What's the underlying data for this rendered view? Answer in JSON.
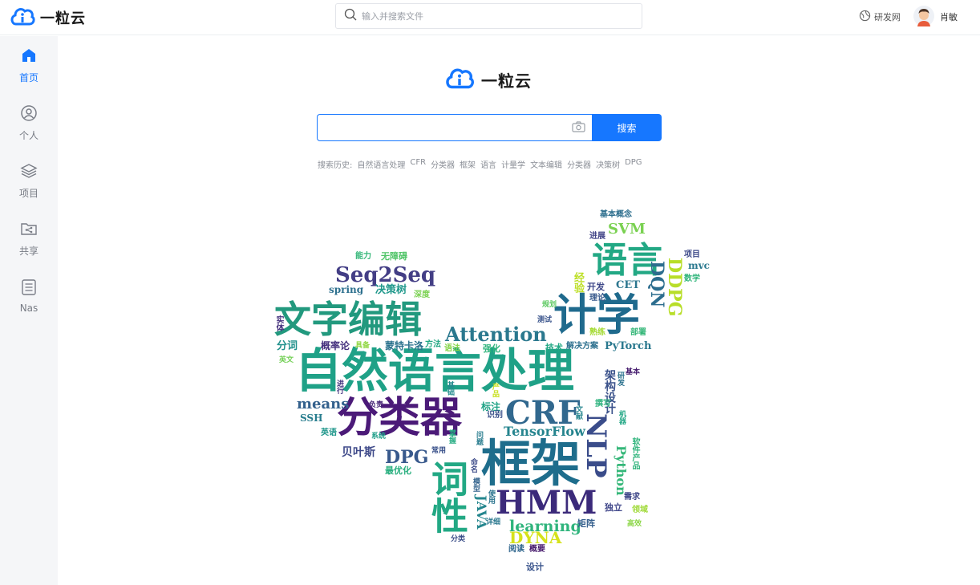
{
  "app": {
    "name": "一粒云"
  },
  "header": {
    "search_placeholder": "输入并搜索文件",
    "network_label": "研发网",
    "user_name": "肖敏"
  },
  "sidebar": {
    "items": [
      {
        "label": "首页",
        "icon": "home-icon",
        "active": true
      },
      {
        "label": "个人",
        "icon": "user-icon",
        "active": false
      },
      {
        "label": "项目",
        "icon": "layers-icon",
        "active": false
      },
      {
        "label": "共享",
        "icon": "shared-folder-icon",
        "active": false
      },
      {
        "label": "Nas",
        "icon": "list-document-icon",
        "active": false
      }
    ]
  },
  "main": {
    "logo_name": "一粒云",
    "search_value": "",
    "search_button": "搜索",
    "history_label": "搜索历史:",
    "history": [
      "自然语言处理",
      "CFR",
      "分类器",
      "框架",
      "语言",
      "计量学",
      "文本编辑",
      "分类器",
      "决策树",
      "DPG"
    ]
  },
  "colors": {
    "accent": "#1677ff",
    "sidebar_bg": "#f5f6f8"
  },
  "word_cloud": [
    {
      "text": "自然语言处理",
      "color": "#1fa187"
    },
    {
      "text": "分类器",
      "color": "#4b1a78"
    },
    {
      "text": "框架",
      "color": "#1e6d8c"
    },
    {
      "text": "计学",
      "color": "#1f6a8d"
    },
    {
      "text": "文字编辑",
      "color": "#22997e"
    },
    {
      "text": "CRF",
      "color": "#31688e"
    },
    {
      "text": "HMM",
      "color": "#3b2a7a"
    },
    {
      "text": "语言",
      "color": "#22a884"
    },
    {
      "text": "Seq2Seq",
      "color": "#433e85"
    },
    {
      "text": "Attention",
      "color": "#2a788e"
    },
    {
      "text": "NLP",
      "color": "#3a4c8a"
    },
    {
      "text": "词性",
      "color": "#22a884"
    },
    {
      "text": "DQN",
      "color": "#2c6d8e"
    },
    {
      "text": "DDPG",
      "color": "#b8de29"
    },
    {
      "text": "SVM",
      "color": "#7ad151"
    },
    {
      "text": "DPG",
      "color": "#38598c"
    },
    {
      "text": "TensorFlow",
      "color": "#25848e"
    },
    {
      "text": "DYNA",
      "color": "#d5e21a"
    },
    {
      "text": "learning",
      "color": "#2fb47c"
    },
    {
      "text": "means",
      "color": "#34618d"
    },
    {
      "text": "贝叶斯",
      "color": "#3e4989"
    },
    {
      "text": "Python",
      "color": "#35b779"
    },
    {
      "text": "PyTorch",
      "color": "#2a788e"
    },
    {
      "text": "架构设计",
      "color": "#3b528b"
    },
    {
      "text": "JAVA",
      "color": "#24868e"
    },
    {
      "text": "spring",
      "color": "#2d708e"
    },
    {
      "text": "决策树",
      "color": "#1f988b"
    },
    {
      "text": "概率论",
      "color": "#46327e"
    },
    {
      "text": "分词",
      "color": "#21918c"
    },
    {
      "text": "蒙特卡洛",
      "color": "#2c728e"
    },
    {
      "text": "方法",
      "color": "#22a884"
    },
    {
      "text": "能力",
      "color": "#35b779"
    },
    {
      "text": "无障碍",
      "color": "#52c569"
    },
    {
      "text": "基本概念",
      "color": "#2e6f8e"
    },
    {
      "text": "进展",
      "color": "#414487"
    },
    {
      "text": "项目",
      "color": "#3e4a89"
    },
    {
      "text": "mvc",
      "color": "#2a788e"
    },
    {
      "text": "数学",
      "color": "#31b57b"
    },
    {
      "text": "开发",
      "color": "#3f4889"
    },
    {
      "text": "CET",
      "color": "#2b758e"
    },
    {
      "text": "经验",
      "color": "#bddf26"
    },
    {
      "text": "理论",
      "color": "#38598c"
    },
    {
      "text": "规划",
      "color": "#5ec962"
    },
    {
      "text": "测试",
      "color": "#3a548c"
    },
    {
      "text": "熟练",
      "color": "#a5db36"
    },
    {
      "text": "部署",
      "color": "#35b779"
    },
    {
      "text": "技术",
      "color": "#22a884"
    },
    {
      "text": "解决方案",
      "color": "#2d708e"
    },
    {
      "text": "深度",
      "color": "#7ad151"
    },
    {
      "text": "语法",
      "color": "#86d549"
    },
    {
      "text": "强化",
      "color": "#2fb47c"
    },
    {
      "text": "具备",
      "color": "#90d743"
    },
    {
      "text": "英文",
      "color": "#73d056"
    },
    {
      "text": "实体",
      "color": "#46327e"
    },
    {
      "text": "基础",
      "color": "#238a8d"
    },
    {
      "text": "产品",
      "color": "#c8e020"
    },
    {
      "text": "标注",
      "color": "#20a386"
    },
    {
      "text": "识别",
      "color": "#3b528b"
    },
    {
      "text": "负责",
      "color": "#482677"
    },
    {
      "text": "进行",
      "color": "#453781"
    },
    {
      "text": "SSH",
      "color": "#287d8e"
    },
    {
      "text": "英语",
      "color": "#1f968b"
    },
    {
      "text": "系统",
      "color": "#1f9e89"
    },
    {
      "text": "常用",
      "color": "#3b528b"
    },
    {
      "text": "最优化",
      "color": "#29af7f"
    },
    {
      "text": "命名",
      "color": "#3e4c8a"
    },
    {
      "text": "模型",
      "color": "#33638d"
    },
    {
      "text": "问题",
      "color": "#287c8e"
    },
    {
      "text": "研发",
      "color": "#2c728e"
    },
    {
      "text": "基本",
      "color": "#481f70"
    },
    {
      "text": "撰写",
      "color": "#2db27d"
    },
    {
      "text": "文献",
      "color": "#25858e"
    },
    {
      "text": "机器",
      "color": "#22a785"
    },
    {
      "text": "软件产品",
      "color": "#2fb47c"
    },
    {
      "text": "需求",
      "color": "#3f4788"
    },
    {
      "text": "独立",
      "color": "#40478a"
    },
    {
      "text": "领域",
      "color": "#a0da39"
    },
    {
      "text": "高效",
      "color": "#8bd646"
    },
    {
      "text": "矩阵",
      "color": "#355f8d"
    },
    {
      "text": "阅读",
      "color": "#31678e"
    },
    {
      "text": "概要",
      "color": "#481b6d"
    },
    {
      "text": "设计",
      "color": "#3a548c"
    },
    {
      "text": "详细",
      "color": "#2a778e"
    },
    {
      "text": "分类",
      "color": "#3c4f8a"
    },
    {
      "text": "使用",
      "color": "#2b748e"
    },
    {
      "text": "掌握",
      "color": "#25ac82"
    }
  ]
}
